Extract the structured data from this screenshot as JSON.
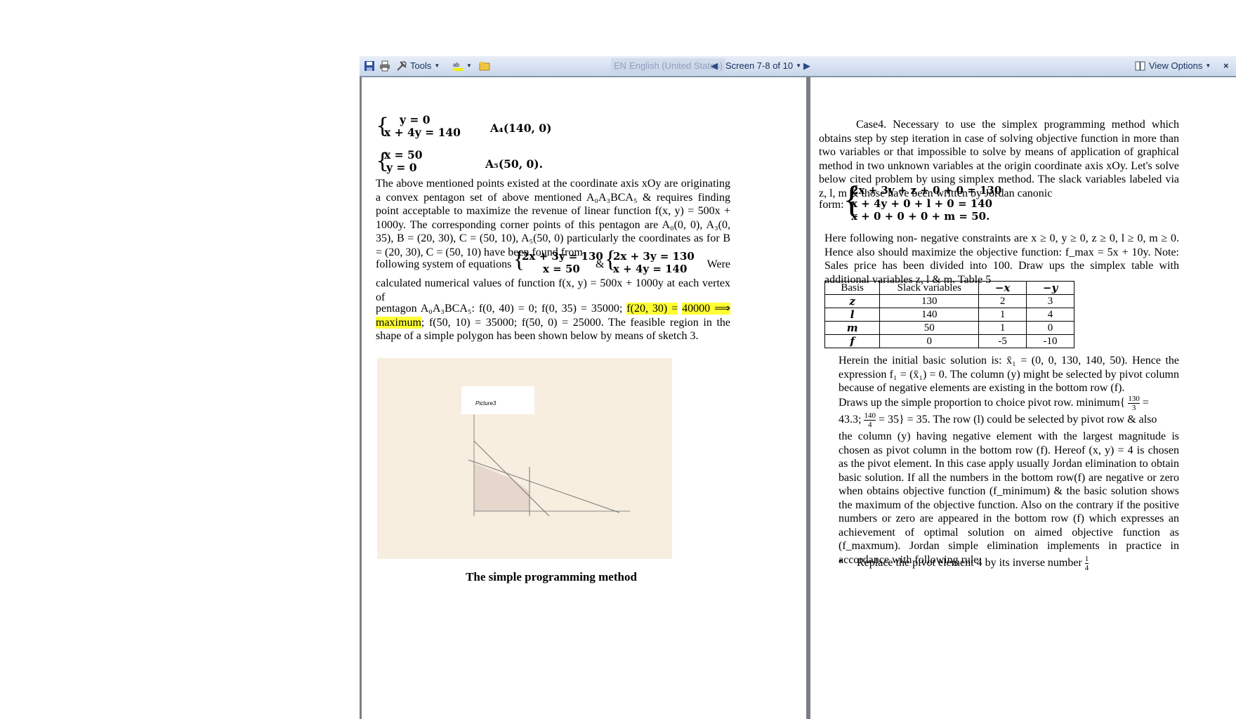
{
  "toolbar": {
    "tools_label": "Tools",
    "language": "English (United States)",
    "lang_code": "EN",
    "screen_indicator": "Screen 7-8 of 10",
    "view_options": "View Options",
    "close": "×"
  },
  "left_page": {
    "sys1_line1": "y = 0",
    "sys1_line2": "x + 4y = 140",
    "sys1_point": "A₄(140, 0)",
    "sys2_line1": "x = 50",
    "sys2_line2": "y = 0",
    "sys2_point": "A₅(50, 0).",
    "paragraph1": "The above mentioned points existed at the coordinate axis xOy are originating a convex pentagon set of above mentioned A₀A₃BCA₅ & requires finding point acceptable to maximize the revenue of linear function f(x, y) = 500x + 1000y.  The corresponding corner points of this pentagon are A₀(0, 0), A₃(0, 35), B = (20, 30), C = (50, 10), A₅(50, 0) particularly the coordinates as for B = (20, 30), C = (50, 10) have been found from",
    "para_eq_prefix": "following system of equations",
    "para_eq_a1": "2x + 3y = 130",
    "para_eq_a2": "x = 50",
    "para_eq_amp": "&",
    "para_eq_b1": "2x + 3y = 130",
    "para_eq_b2": "x + 4y = 140",
    "para_eq_suffix": "Were",
    "paragraph2a": "calculated numerical values of function f(x, y) = 500x + 1000y at each vertex of",
    "paragraph2b_pre": "pentagon A₀A₃BCA₅: f(0, 40) = 0; f(0, 35) = 35000; ",
    "paragraph2b_hl1": "f(20, 30) =",
    "paragraph2b_hl2": "40000 ⟹ maximum",
    "paragraph2b_post": "; f(50, 10) = 35000; f(50, 0) = 25000. The feasible region in the shape of a simple polygon has been shown below by means of sketch 3.",
    "picture_caption": "Picture3",
    "section_heading": "The simple programming method"
  },
  "right_page": {
    "case_para": "Case4. Necessary to use the simplex programming method which obtains step by step iteration in case of solving objective function in more than two variables or that impossible to solve by means of application of graphical method in two unknown variables at the origin coordinate axis xOy. Let's solve below cited problem by using simplex method. The slack variables labeled via z, l, m & those have been written by Jordan canonic",
    "form_label": "form:",
    "form_eq1": "2x + 3y + z + 0 + 0 = 130",
    "form_eq2": "x + 4y + 0 + l + 0 = 140",
    "form_eq3": "x + 0 + 0 + 0 + m = 50.",
    "constraints_para": "Here following non- negative constraints are x ≥ 0, y ≥ 0, z ≥ 0, l ≥ 0, m ≥ 0.  Hence also should maximize the objective function: f_max = 5x + 10y. Note: Sales price has been divided into 100. Draw ups the simplex table with additional variables z, l & m. Table 5",
    "table": {
      "headers": [
        "Basis",
        "Slack variables",
        "−x",
        "−y"
      ],
      "rows": [
        [
          "z",
          "130",
          "2",
          "3"
        ],
        [
          "l",
          "140",
          "1",
          "4"
        ],
        [
          "m",
          "50",
          "1",
          "0"
        ],
        [
          "f",
          "0",
          "-5",
          "-10"
        ]
      ]
    },
    "herein_para1": "Herein the initial basic solution is: x̄₁ = (0, 0, 130, 140, 50). Hence the expression f₁ = (x̄₁) = 0. The column (y) might be selected by pivot column because of negative elements are existing in the bottom row (f).",
    "herein_para2_pre": "Draws up the simple proportion to choice pivot row. minimum{",
    "frac1_num": "130",
    "frac1_den": "3",
    "herein_para3_pre": "43.3;",
    "frac2_num": "140",
    "frac2_den": "4",
    "herein_para3_post": "= 35} = 35. The row (l) could be selected by pivot row & also",
    "herein_para4": "the column (y) having negative element with the largest magnitude is chosen as pivot column in the bottom row (f). Hereof (x, y) = 4 is chosen as the pivot element.  In this case apply usually Jordan elimination to obtain basic solution. If all the numbers in the bottom row(f) are negative or zero when obtains objective function (f_minimum) & the basic solution shows the maximum of the objective function. Also on the contrary if the positive numbers or zero are appeared in the bottom row (f) which expresses an achievement of optimal solution on aimed objective function as (f_maxmum). Jordan simple elimination implements in practice in accordance with following rule:",
    "bullet1": "Replace the pivot element 4 by its inverse number",
    "bullet_frac_num": "1",
    "bullet_frac_den": "4"
  }
}
